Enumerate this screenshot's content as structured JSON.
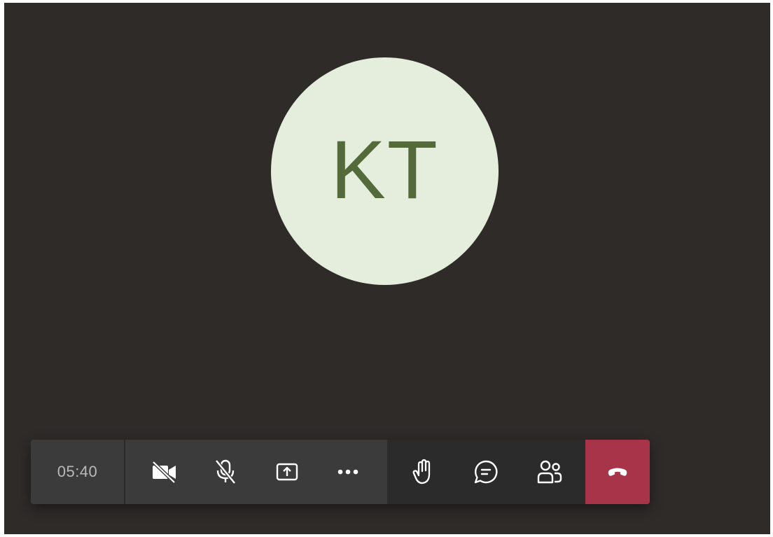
{
  "participant": {
    "initials": "KT"
  },
  "call": {
    "duration": "05:40"
  },
  "toolbar": {
    "buttons": [
      {
        "icon": "camera-off-icon"
      },
      {
        "icon": "mic-off-icon"
      },
      {
        "icon": "share-screen-icon"
      },
      {
        "icon": "more-options-icon"
      },
      {
        "icon": "raise-hand-icon"
      },
      {
        "icon": "chat-icon"
      },
      {
        "icon": "participants-icon"
      },
      {
        "icon": "hang-up-icon"
      }
    ]
  },
  "colors": {
    "background": "#2f2b29",
    "avatar_bg": "#e5eddc",
    "avatar_text": "#556a3a",
    "toolbar_bg": "#3b3b3b",
    "toolbar_side_bg": "#2b2b2b",
    "hangup_bg": "#a73448"
  }
}
